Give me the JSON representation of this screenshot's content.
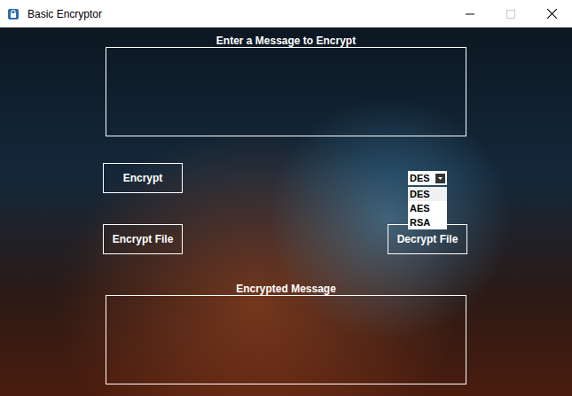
{
  "window": {
    "title": "Basic Encryptor",
    "maximize_enabled": false
  },
  "input": {
    "label": "Enter a Message to Encrypt",
    "value": ""
  },
  "buttons": {
    "encrypt": "Encrypt",
    "encrypt_file": "Encrypt File",
    "decrypt_file": "Decrypt File"
  },
  "algorithm": {
    "value": "DES",
    "open": true,
    "options": [
      {
        "label": "DES",
        "selected": true
      },
      {
        "label": "AES",
        "selected": false
      },
      {
        "label": "RSA",
        "selected": false
      }
    ]
  },
  "output": {
    "label": "Encrypted Message",
    "value": ""
  }
}
